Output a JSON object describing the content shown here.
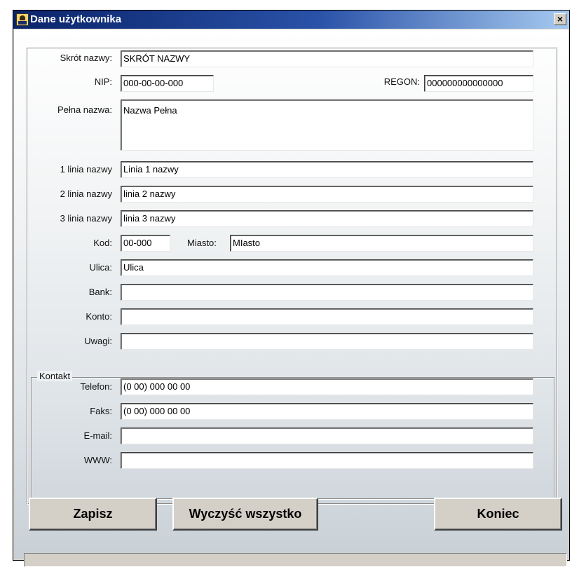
{
  "window": {
    "title": "Dane użytkownika",
    "close_label": "×"
  },
  "form": {
    "skrot_label": "Skrót nazwy:",
    "skrot_value": "SKRÓT NAZWY",
    "nip_label": "NIP:",
    "nip_value": "000-00-00-000",
    "regon_label": "REGON:",
    "regon_value": "000000000000000",
    "pelna_label": "Pełna nazwa:",
    "pelna_value": "Nazwa Pełna",
    "linia1_label": "1 linia nazwy",
    "linia1_value": "Linia 1 nazwy",
    "linia2_label": "2 linia nazwy",
    "linia2_value": "linia 2 nazwy",
    "linia3_label": "3 linia nazwy",
    "linia3_value": "linia 3 nazwy",
    "kod_label": "Kod:",
    "kod_value": "00-000",
    "miasto_label": "Miasto:",
    "miasto_value": "MIasto",
    "ulica_label": "Ulica:",
    "ulica_value": "Ulica",
    "bank_label": "Bank:",
    "bank_value": "",
    "konto_label": "Konto:",
    "konto_value": "",
    "uwagi_label": "Uwagi:",
    "uwagi_value": ""
  },
  "kontakt": {
    "group_title": "Kontakt",
    "telefon_label": "Telefon:",
    "telefon_value": "(0 00) 000 00 00",
    "faks_label": "Faks:",
    "faks_value": "(0 00) 000 00 00",
    "email_label": "E-mail:",
    "email_value": "",
    "www_label": "WWW:",
    "www_value": ""
  },
  "buttons": {
    "save": "Zapisz",
    "clear_all": "Wyczyść wszystko",
    "exit": "Koniec"
  },
  "status": {
    "text": ""
  }
}
